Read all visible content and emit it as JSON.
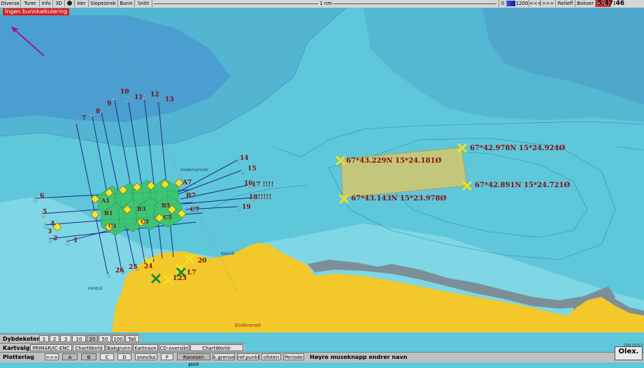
{
  "toolbar": {
    "items": [
      "Diverse",
      "Turer",
      "Info",
      "3D",
      "Her",
      "Slepestrek",
      "Bunn",
      "Snitt"
    ],
    "scale": "1 nm",
    "depth_min": "0",
    "depth_max": "1200",
    "nav_back": "<<<",
    "nav_fwd": ">>>",
    "relief": "Relieff",
    "boxes": "Bokser",
    "print": "Print",
    "clock": "5:47:46"
  },
  "warning": "Ingen bunnkalkulering",
  "waypoints": [
    {
      "label": "67*43.229N 15*24.181Ø"
    },
    {
      "label": "67*42.978N 15*24.924Ø"
    },
    {
      "label": "67*43.143N 15*23.978Ø"
    },
    {
      "label": "67*42.891N 15*24.721Ø"
    }
  ],
  "track_numbers": [
    "1",
    "2",
    "3",
    "4",
    "5",
    "6",
    "7",
    "8",
    "9",
    "10",
    "11",
    "12",
    "13",
    "14",
    "15",
    "16",
    "17 !!!!",
    "18!!!!!",
    "19",
    "20",
    "24",
    "25",
    "26",
    "L7",
    "L23"
  ],
  "grid_labels": [
    "A7",
    "B7",
    "C7",
    "A1",
    "B1",
    "C1",
    "B3",
    "C3",
    "B5",
    "C5"
  ],
  "place_names": [
    "Undervannsk",
    "Endeneset",
    "Hinbrå",
    "Kjelvik"
  ],
  "dybdekoter": {
    "label": "Dybdekoter",
    "values": [
      "1",
      "2",
      "3",
      "10",
      "20",
      "50",
      "100",
      "Tall"
    ],
    "selected": "20"
  },
  "kartvalg": {
    "label": "Kartvalg",
    "values": [
      "PRIMAR/IC-ENC",
      "ChartWorld",
      "Bakgrunn",
      "Kartnavn",
      "CD-oversikt",
      "ChartWorld-versjoner"
    ]
  },
  "plotterlag": {
    "label": "Plotterlag",
    "nav": ">>>",
    "values": [
      "A",
      "B",
      "C",
      "D",
      "snevika",
      "F",
      "Ranesen ploit",
      "k.grense",
      "ref.punkt",
      "ofoten",
      "Periode"
    ],
    "hint": "Høyre museknapp endrer navn"
  },
  "cpu": "CPU 10°C?",
  "brand": "Olex."
}
